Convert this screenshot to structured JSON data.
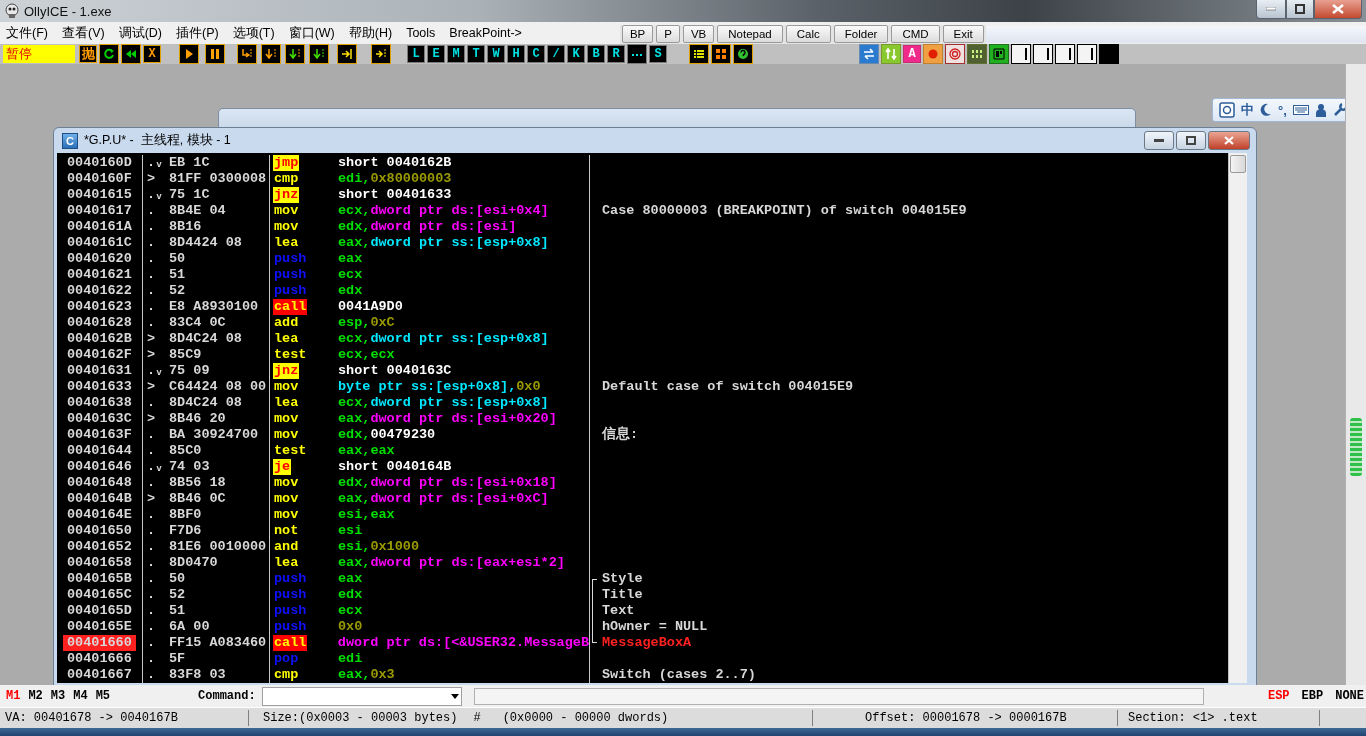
{
  "window": {
    "title": "OllyICE - 1.exe"
  },
  "menu": [
    "文件(F)",
    "查看(V)",
    "调试(D)",
    "插件(P)",
    "选项(T)",
    "窗口(W)",
    "帮助(H)",
    "Tools",
    "BreakPoint->"
  ],
  "quick_buttons": [
    "BP",
    "P",
    "VB",
    "Notepad",
    "Calc",
    "Folder",
    "CMD",
    "Exit"
  ],
  "toolbar": {
    "status": "暂停",
    "labels": [
      "抛",
      "X"
    ],
    "view_buttons": [
      {
        "kind": "letter",
        "text": "L"
      },
      {
        "kind": "letter",
        "text": "E"
      },
      {
        "kind": "letter",
        "text": "M"
      },
      {
        "kind": "letter",
        "text": "T"
      },
      {
        "kind": "letter",
        "text": "W"
      },
      {
        "kind": "letter",
        "text": "H"
      },
      {
        "kind": "letter",
        "text": "C"
      },
      {
        "kind": "letter",
        "text": "/"
      },
      {
        "kind": "letter",
        "text": "K"
      },
      {
        "kind": "letter",
        "text": "B"
      },
      {
        "kind": "letter",
        "text": "R"
      },
      {
        "kind": "dots"
      },
      {
        "kind": "letter",
        "text": "S"
      }
    ],
    "plugin_labels": [
      "A"
    ]
  },
  "ime_bar": {
    "mode": "中",
    "punctuation": "°,"
  },
  "cpu_window": {
    "icon_letter": "C",
    "title": "*G.P.U* -  主线程, 模块 - 1",
    "rows": [
      {
        "address": "0040160D",
        "breakpoint": false,
        "marker": ".ᵥ",
        "hex": "EB 1C",
        "mnemonic": "jmp",
        "kind": "jump",
        "operand": [
          {
            "kind": "addr",
            "text": "short 0040162B"
          }
        ]
      },
      {
        "address": "0040160F",
        "breakpoint": false,
        "marker": ">",
        "hex": "81FF 0300008",
        "mnemonic": "cmp",
        "kind": "normal",
        "operand": [
          {
            "kind": "reg",
            "text": "edi,"
          },
          {
            "kind": "imm",
            "text": "0x80000003"
          }
        ]
      },
      {
        "address": "00401615",
        "breakpoint": false,
        "marker": ".ᵥ",
        "hex": "75 1C",
        "mnemonic": "jnz",
        "kind": "jump",
        "operand": [
          {
            "kind": "addr",
            "text": "short 00401633"
          }
        ]
      },
      {
        "address": "00401617",
        "breakpoint": false,
        "marker": ".",
        "hex": "8B4E 04",
        "mnemonic": "mov",
        "kind": "normal",
        "operand": [
          {
            "kind": "reg",
            "text": "ecx,"
          },
          {
            "kind": "mem",
            "text": "dword ptr ds:[esi+0x4]"
          }
        ],
        "comment": {
          "text": "Case 80000003 (BREAKPOINT) of switch 004015E9",
          "kind": "plain"
        }
      },
      {
        "address": "0040161A",
        "breakpoint": false,
        "marker": ".",
        "hex": "8B16",
        "mnemonic": "mov",
        "kind": "normal",
        "operand": [
          {
            "kind": "reg",
            "text": "edx,"
          },
          {
            "kind": "mem",
            "text": "dword ptr ds:[esi]"
          }
        ]
      },
      {
        "address": "0040161C",
        "breakpoint": false,
        "marker": ".",
        "hex": "8D4424 08",
        "mnemonic": "lea",
        "kind": "normal",
        "operand": [
          {
            "kind": "reg",
            "text": "eax,"
          },
          {
            "kind": "stack",
            "text": "dword ptr ss:[esp+0x8]"
          }
        ]
      },
      {
        "address": "00401620",
        "breakpoint": false,
        "marker": ".",
        "hex": "50",
        "mnemonic": "push",
        "kind": "push",
        "operand": [
          {
            "kind": "reg",
            "text": "eax"
          }
        ]
      },
      {
        "address": "00401621",
        "breakpoint": false,
        "marker": ".",
        "hex": "51",
        "mnemonic": "push",
        "kind": "push",
        "operand": [
          {
            "kind": "reg",
            "text": "ecx"
          }
        ]
      },
      {
        "address": "00401622",
        "breakpoint": false,
        "marker": ".",
        "hex": "52",
        "mnemonic": "push",
        "kind": "push",
        "operand": [
          {
            "kind": "reg",
            "text": "edx"
          }
        ]
      },
      {
        "address": "00401623",
        "breakpoint": false,
        "marker": ".",
        "hex": "E8 A8930100",
        "mnemonic": "call",
        "kind": "call",
        "operand": [
          {
            "kind": "addr",
            "text": "0041A9D0"
          }
        ]
      },
      {
        "address": "00401628",
        "breakpoint": false,
        "marker": ".",
        "hex": "83C4 0C",
        "mnemonic": "add",
        "kind": "normal",
        "operand": [
          {
            "kind": "reg",
            "text": "esp,"
          },
          {
            "kind": "imm",
            "text": "0xC"
          }
        ]
      },
      {
        "address": "0040162B",
        "breakpoint": false,
        "marker": ">",
        "hex": "8D4C24 08",
        "mnemonic": "lea",
        "kind": "normal",
        "operand": [
          {
            "kind": "reg",
            "text": "ecx,"
          },
          {
            "kind": "stack",
            "text": "dword ptr ss:[esp+0x8]"
          }
        ]
      },
      {
        "address": "0040162F",
        "breakpoint": false,
        "marker": ">",
        "hex": "85C9",
        "mnemonic": "test",
        "kind": "normal",
        "operand": [
          {
            "kind": "reg",
            "text": "ecx,ecx"
          }
        ]
      },
      {
        "address": "00401631",
        "breakpoint": false,
        "marker": ".ᵥ",
        "hex": "75 09",
        "mnemonic": "jnz",
        "kind": "jump",
        "operand": [
          {
            "kind": "addr",
            "text": "short 0040163C"
          }
        ]
      },
      {
        "address": "00401633",
        "breakpoint": false,
        "marker": ">",
        "hex": "C64424 08 00",
        "mnemonic": "mov",
        "kind": "normal",
        "operand": [
          {
            "kind": "stack",
            "text": "byte ptr ss:[esp+0x8],"
          },
          {
            "kind": "imm",
            "text": "0x0"
          }
        ],
        "comment": {
          "text": "Default case of switch 004015E9",
          "kind": "plain"
        }
      },
      {
        "address": "00401638",
        "breakpoint": false,
        "marker": ".",
        "hex": "8D4C24 08",
        "mnemonic": "lea",
        "kind": "normal",
        "operand": [
          {
            "kind": "reg",
            "text": "ecx,"
          },
          {
            "kind": "stack",
            "text": "dword ptr ss:[esp+0x8]"
          }
        ]
      },
      {
        "address": "0040163C",
        "breakpoint": false,
        "marker": ">",
        "hex": "8B46 20",
        "mnemonic": "mov",
        "kind": "normal",
        "operand": [
          {
            "kind": "reg",
            "text": "eax,"
          },
          {
            "kind": "mem",
            "text": "dword ptr ds:[esi+0x20]"
          }
        ]
      },
      {
        "address": "0040163F",
        "breakpoint": false,
        "marker": ".",
        "hex": "BA 30924700",
        "mnemonic": "mov",
        "kind": "normal",
        "operand": [
          {
            "kind": "reg",
            "text": "edx,"
          },
          {
            "kind": "addr",
            "text": "00479230"
          }
        ],
        "comment": {
          "text": "信息:",
          "kind": "plain"
        }
      },
      {
        "address": "00401644",
        "breakpoint": false,
        "marker": ".",
        "hex": "85C0",
        "mnemonic": "test",
        "kind": "normal",
        "operand": [
          {
            "kind": "reg",
            "text": "eax,eax"
          }
        ]
      },
      {
        "address": "00401646",
        "breakpoint": false,
        "marker": ".ᵥ",
        "hex": "74 03",
        "mnemonic": "je",
        "kind": "jump",
        "operand": [
          {
            "kind": "addr",
            "text": "short 0040164B"
          }
        ]
      },
      {
        "address": "00401648",
        "breakpoint": false,
        "marker": ".",
        "hex": "8B56 18",
        "mnemonic": "mov",
        "kind": "normal",
        "operand": [
          {
            "kind": "reg",
            "text": "edx,"
          },
          {
            "kind": "mem",
            "text": "dword ptr ds:[esi+0x18]"
          }
        ]
      },
      {
        "address": "0040164B",
        "breakpoint": false,
        "marker": ">",
        "hex": "8B46 0C",
        "mnemonic": "mov",
        "kind": "normal",
        "operand": [
          {
            "kind": "reg",
            "text": "eax,"
          },
          {
            "kind": "mem",
            "text": "dword ptr ds:[esi+0xC]"
          }
        ]
      },
      {
        "address": "0040164E",
        "breakpoint": false,
        "marker": ".",
        "hex": "8BF0",
        "mnemonic": "mov",
        "kind": "normal",
        "operand": [
          {
            "kind": "reg",
            "text": "esi,eax"
          }
        ]
      },
      {
        "address": "00401650",
        "breakpoint": false,
        "marker": ".",
        "hex": "F7D6",
        "mnemonic": "not",
        "kind": "normal",
        "operand": [
          {
            "kind": "reg",
            "text": "esi"
          }
        ]
      },
      {
        "address": "00401652",
        "breakpoint": false,
        "marker": ".",
        "hex": "81E6 0010000",
        "mnemonic": "and",
        "kind": "normal",
        "operand": [
          {
            "kind": "reg",
            "text": "esi,"
          },
          {
            "kind": "imm",
            "text": "0x1000"
          }
        ]
      },
      {
        "address": "00401658",
        "breakpoint": false,
        "marker": ".",
        "hex": "8D0470",
        "mnemonic": "lea",
        "kind": "normal",
        "operand": [
          {
            "kind": "reg",
            "text": "eax,"
          },
          {
            "kind": "mem",
            "text": "dword ptr ds:[eax+esi*2]"
          }
        ]
      },
      {
        "address": "0040165B",
        "breakpoint": false,
        "marker": ".",
        "hex": "50",
        "mnemonic": "push",
        "kind": "push",
        "operand": [
          {
            "kind": "reg",
            "text": "eax"
          }
        ],
        "comment": {
          "text": "Style",
          "kind": "bracket_start"
        }
      },
      {
        "address": "0040165C",
        "breakpoint": false,
        "marker": ".",
        "hex": "52",
        "mnemonic": "push",
        "kind": "push",
        "operand": [
          {
            "kind": "reg",
            "text": "edx"
          }
        ],
        "comment": {
          "text": "Title",
          "kind": "bracket_middle"
        }
      },
      {
        "address": "0040165D",
        "breakpoint": false,
        "marker": ".",
        "hex": "51",
        "mnemonic": "push",
        "kind": "push",
        "operand": [
          {
            "kind": "reg",
            "text": "ecx"
          }
        ],
        "comment": {
          "text": "Text",
          "kind": "bracket_middle"
        }
      },
      {
        "address": "0040165E",
        "breakpoint": false,
        "marker": ".",
        "hex": "6A 00",
        "mnemonic": "push",
        "kind": "push",
        "operand": [
          {
            "kind": "imm",
            "text": "0x0"
          }
        ],
        "comment": {
          "text": "hOwner = NULL",
          "kind": "bracket_middle"
        }
      },
      {
        "address": "00401660",
        "breakpoint": true,
        "marker": ".",
        "hex": "FF15 A083460",
        "mnemonic": "call",
        "kind": "call",
        "operand": [
          {
            "kind": "mem",
            "text": "dword ptr ds:[<&USER32.MessageB"
          }
        ],
        "comment": {
          "text": "MessageBoxA",
          "kind": "bracket_end",
          "api": true
        }
      },
      {
        "address": "00401666",
        "breakpoint": false,
        "marker": ".",
        "hex": "5F",
        "mnemonic": "pop",
        "kind": "push",
        "operand": [
          {
            "kind": "reg",
            "text": "edi"
          }
        ]
      },
      {
        "address": "00401667",
        "breakpoint": false,
        "marker": ".",
        "hex": "83F8 03",
        "mnemonic": "cmp",
        "kind": "normal",
        "operand": [
          {
            "kind": "reg",
            "text": "eax,"
          },
          {
            "kind": "imm",
            "text": "0x3"
          }
        ],
        "comment": {
          "text": "Switch (cases 2..7)",
          "kind": "plain"
        }
      }
    ]
  },
  "command_bar": {
    "memory_tabs": [
      {
        "label": "M1",
        "selected": true
      },
      {
        "label": "M2",
        "selected": false
      },
      {
        "label": "M3",
        "selected": false
      },
      {
        "label": "M4",
        "selected": false
      },
      {
        "label": "M5",
        "selected": false
      }
    ],
    "label": "Command:",
    "registers": [
      {
        "label": "ESP",
        "selected": true
      },
      {
        "label": "EBP",
        "selected": false
      },
      {
        "label": "NONE",
        "selected": false
      }
    ]
  },
  "status_bar": {
    "va": "VA: 00401678 -> 0040167B",
    "size": "Size:(0x0003 - 00003 bytes)",
    "hash": "#",
    "dwords": "(0x0000 - 00000 dwords)",
    "offset": "Offset: 00001678 -> 0000167B",
    "section": "Section: <1> .text"
  }
}
